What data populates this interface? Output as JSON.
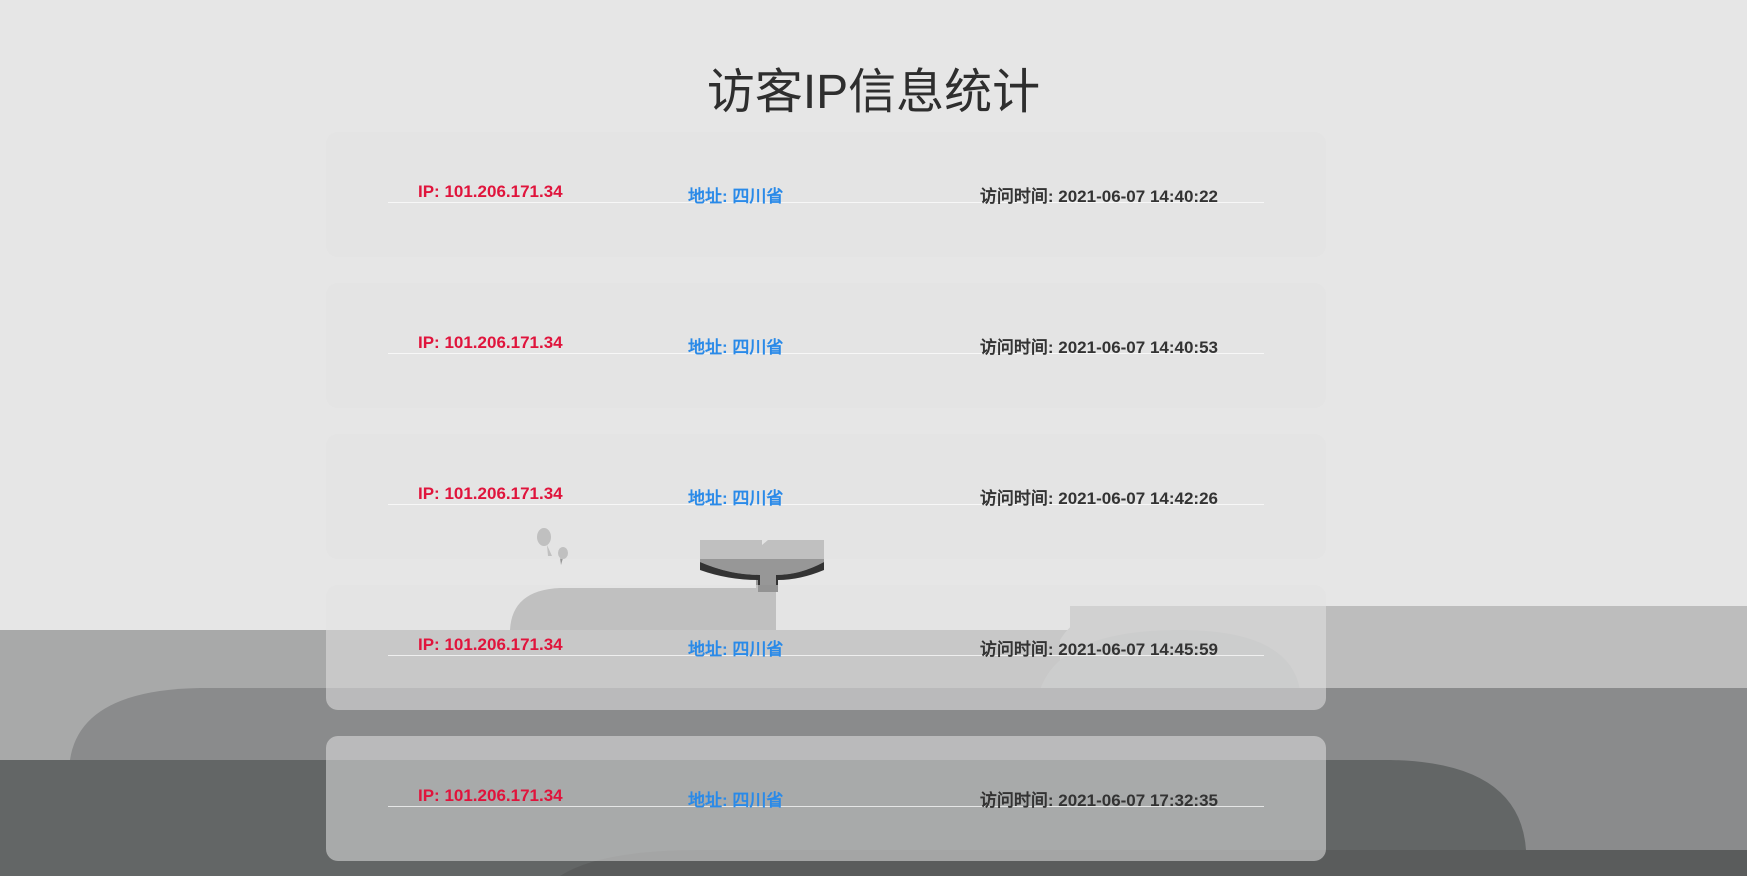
{
  "page": {
    "title": "访客IP信息统计"
  },
  "colors": {
    "ip": "#e0143c",
    "address": "#2a8ae8",
    "time": "#333333",
    "background": "#e6e6e6"
  },
  "records": [
    {
      "ip": "IP: 101.206.171.34",
      "address": "地址: 四川省",
      "time": "访问时间: 2021-06-07 14:40:22"
    },
    {
      "ip": "IP: 101.206.171.34",
      "address": "地址: 四川省",
      "time": "访问时间: 2021-06-07 14:40:53"
    },
    {
      "ip": "IP: 101.206.171.34",
      "address": "地址: 四川省",
      "time": "访问时间: 2021-06-07 14:42:26"
    },
    {
      "ip": "IP: 101.206.171.34",
      "address": "地址: 四川省",
      "time": "访问时间: 2021-06-07 14:45:59"
    },
    {
      "ip": "IP: 101.206.171.34",
      "address": "地址: 四川省",
      "time": "访问时间: 2021-06-07 17:32:35"
    }
  ]
}
